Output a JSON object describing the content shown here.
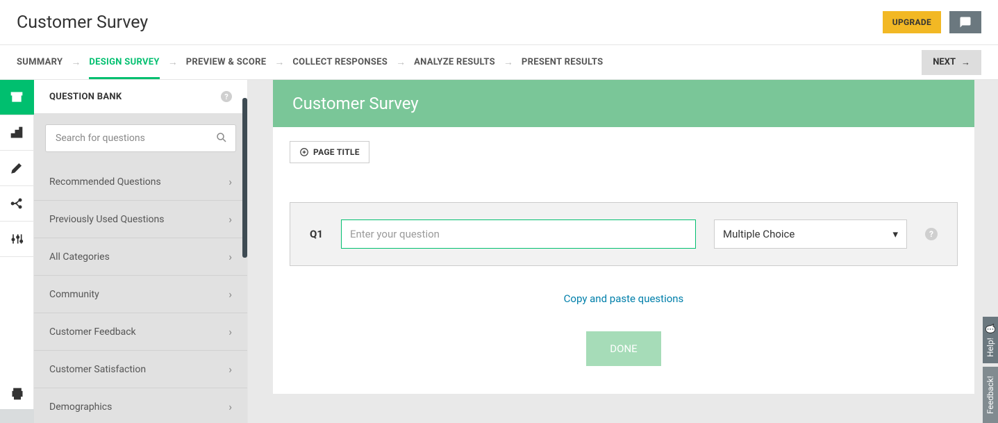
{
  "header": {
    "title": "Customer Survey",
    "upgrade_label": "UPGRADE"
  },
  "crumbs": {
    "items": [
      "SUMMARY",
      "DESIGN SURVEY",
      "PREVIEW & SCORE",
      "COLLECT RESPONSES",
      "ANALYZE RESULTS",
      "PRESENT RESULTS"
    ],
    "active_index": 1,
    "next_label": "NEXT"
  },
  "sidebar": {
    "title": "QUESTION BANK",
    "search_placeholder": "Search for questions",
    "categories": [
      "Recommended Questions",
      "Previously Used Questions",
      "All Categories",
      "Community",
      "Customer Feedback",
      "Customer Satisfaction",
      "Demographics"
    ]
  },
  "canvas": {
    "banner_title": "Customer Survey",
    "page_title_btn": "PAGE TITLE",
    "q_label": "Q1",
    "q_placeholder": "Enter your question",
    "q_type": "Multiple Choice",
    "copy_link": "Copy and paste questions",
    "done_label": "DONE"
  },
  "sidetabs": {
    "help": "Help!",
    "feedback": "Feedback!"
  }
}
